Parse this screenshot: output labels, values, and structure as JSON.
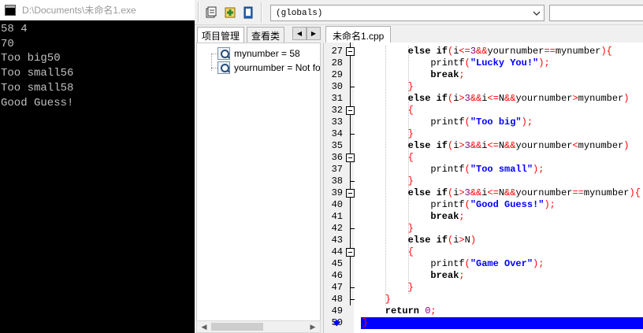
{
  "console": {
    "title": "D:\\Documents\\未命名1.exe",
    "lines": [
      "58 4",
      "70",
      "Too big50",
      "Too small56",
      "Too small58",
      "Good Guess!"
    ]
  },
  "toolbar": {
    "scope_value": "(globals)",
    "icons": [
      "debug-window-icon",
      "add-watch-icon",
      "bookmark-icon"
    ]
  },
  "left_panel": {
    "tabs": [
      "项目管理",
      "查看类"
    ],
    "tree_items": [
      {
        "icon": "variable-icon",
        "label": "mynumber = 58"
      },
      {
        "icon": "variable-icon",
        "label": "yournumber = Not fo"
      }
    ]
  },
  "editor": {
    "file_tab": "未命名1.cpp",
    "line_numbers": [
      "27",
      "28",
      "29",
      "30",
      "31",
      "32",
      "33",
      "34",
      "35",
      "36",
      "37",
      "38",
      "39",
      "40",
      "41",
      "42",
      "43",
      "44",
      "45",
      "46",
      "47",
      "48",
      "49",
      "50"
    ],
    "code_lines": [
      "else if(i<=3&&yournumber==mynumber){",
      "printf(\"Lucky You!\");",
      "break;",
      "}",
      "else if(i>3&&i<=N&&yournumber>mynumber)",
      "{",
      "printf(\"Too big\");",
      "}",
      "else if(i>3&&i<=N&&yournumber<mynumber)",
      "{",
      "printf(\"Too small\");",
      "}",
      "else if(i>3&&i<=N&&yournumber==mynumber){",
      "printf(\"Good Guess!\");",
      "break;",
      "}",
      "else if(i>N)",
      "{",
      "printf(\"Game Over\");",
      "break;",
      "}",
      "}",
      "return 0;",
      "}"
    ],
    "current_line": "50",
    "colors": {
      "keyword": "#000000",
      "operator": "#ff0000",
      "string": "#0000ff",
      "number": "#800080",
      "current_line_bg": "#0000ff"
    }
  }
}
